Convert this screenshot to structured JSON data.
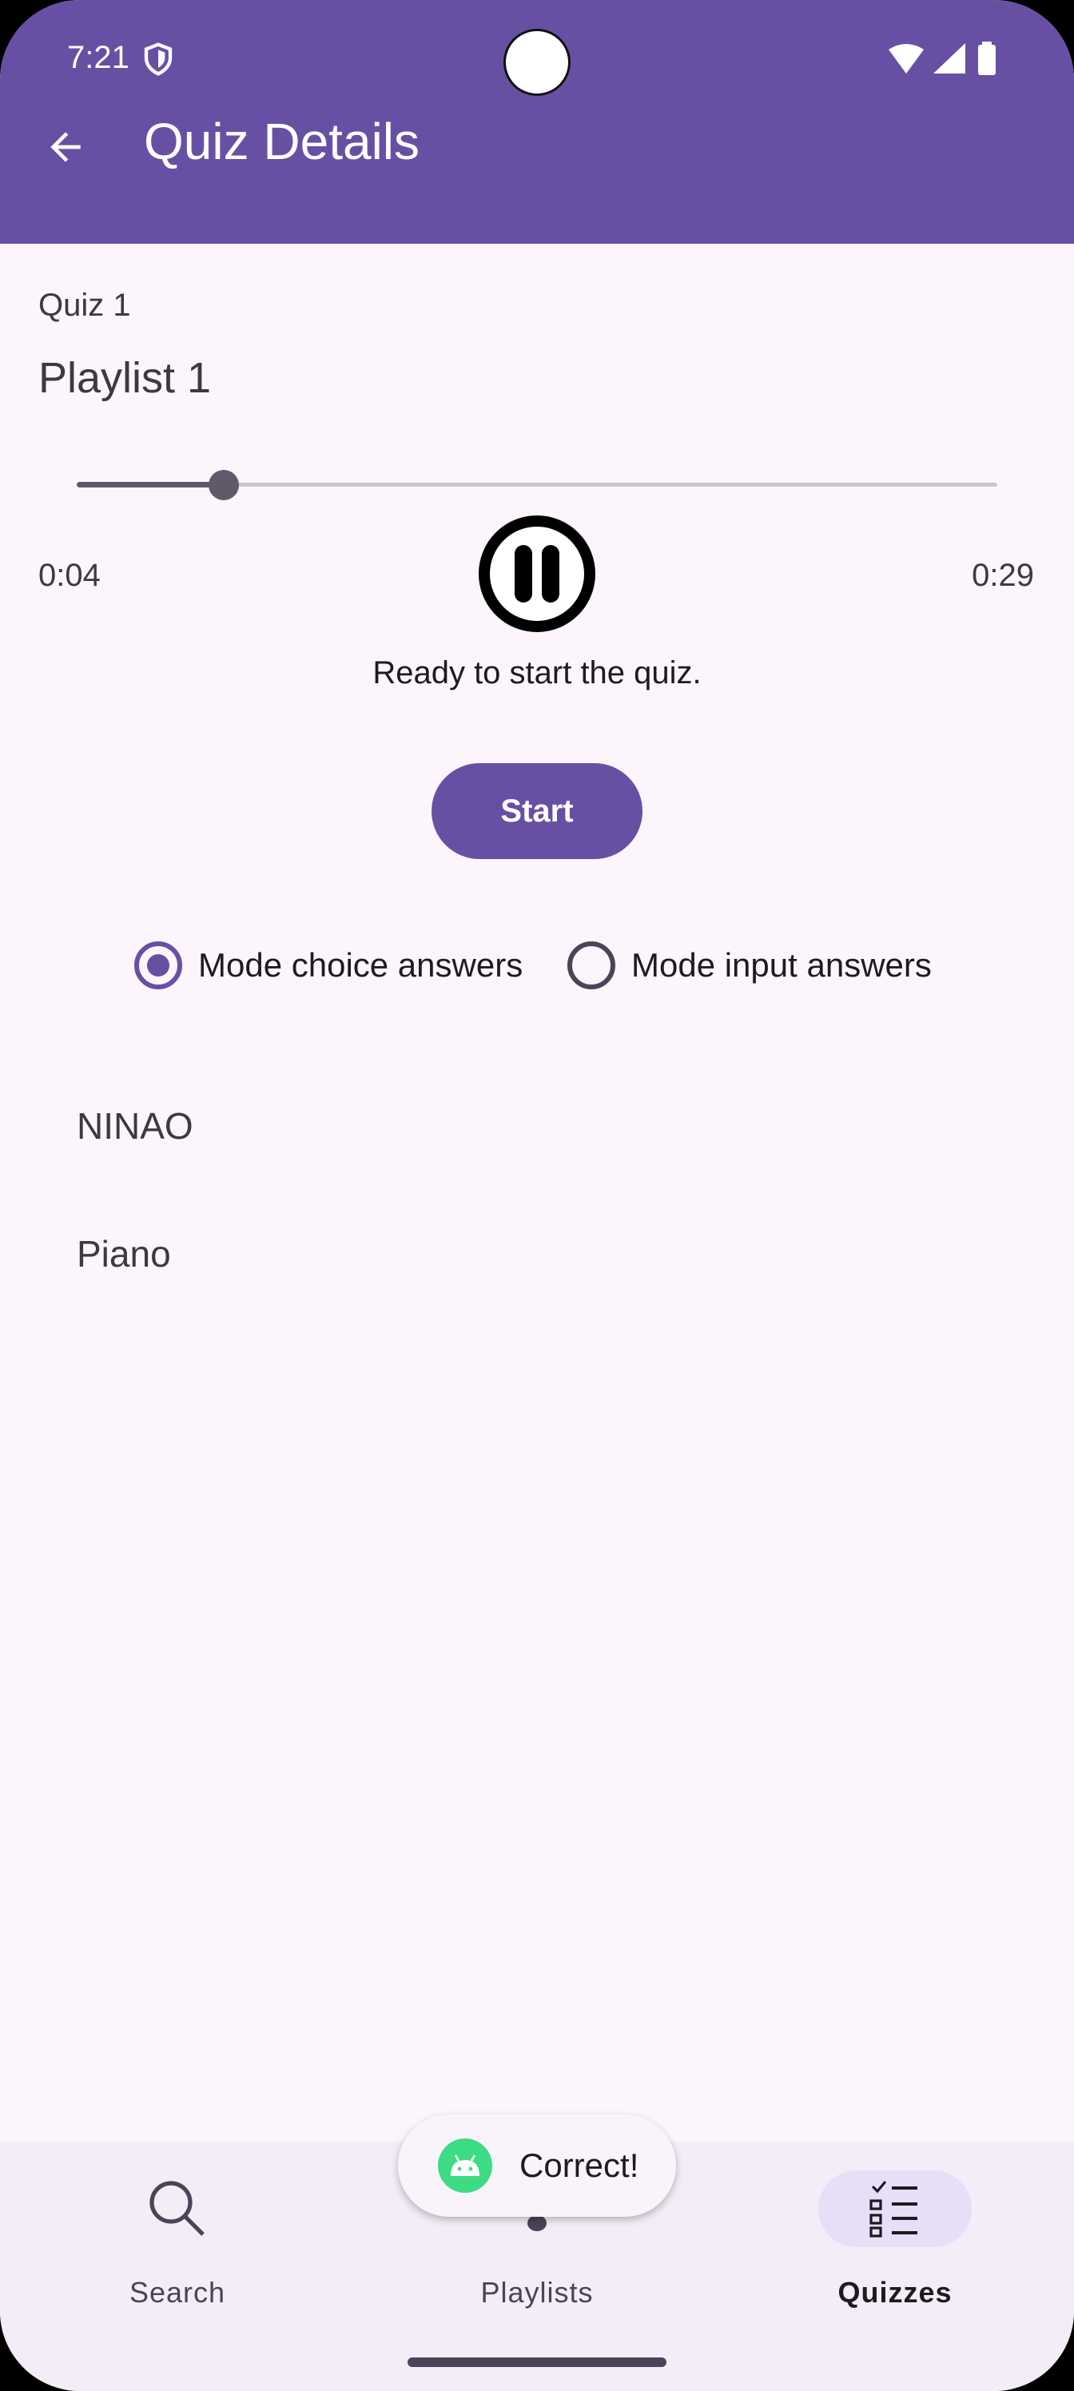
{
  "status_bar": {
    "time": "7:21"
  },
  "app_bar": {
    "title": "Quiz Details"
  },
  "quiz": {
    "quiz_name": "Quiz 1",
    "playlist_name": "Playlist 1"
  },
  "player": {
    "elapsed": "0:04",
    "duration": "0:29",
    "progress_fraction": 0.16
  },
  "status_message": "Ready to start the quiz.",
  "start_label": "Start",
  "modes": [
    {
      "label": "Mode choice answers",
      "selected": true
    },
    {
      "label": "Mode input answers",
      "selected": false
    }
  ],
  "answers": [
    "NINAO",
    "Piano"
  ],
  "toast": {
    "text": "Correct!"
  },
  "nav": [
    {
      "label": "Search",
      "icon": "search-icon",
      "active": false
    },
    {
      "label": "Playlists",
      "icon": "playlists-icon",
      "active": false
    },
    {
      "label": "Quizzes",
      "icon": "quizzes-icon",
      "active": true
    }
  ],
  "colors": {
    "primary": "#6750a4",
    "background": "#fcf5fb",
    "nav_bg": "#f3edf7",
    "nav_active": "#e8def8"
  }
}
